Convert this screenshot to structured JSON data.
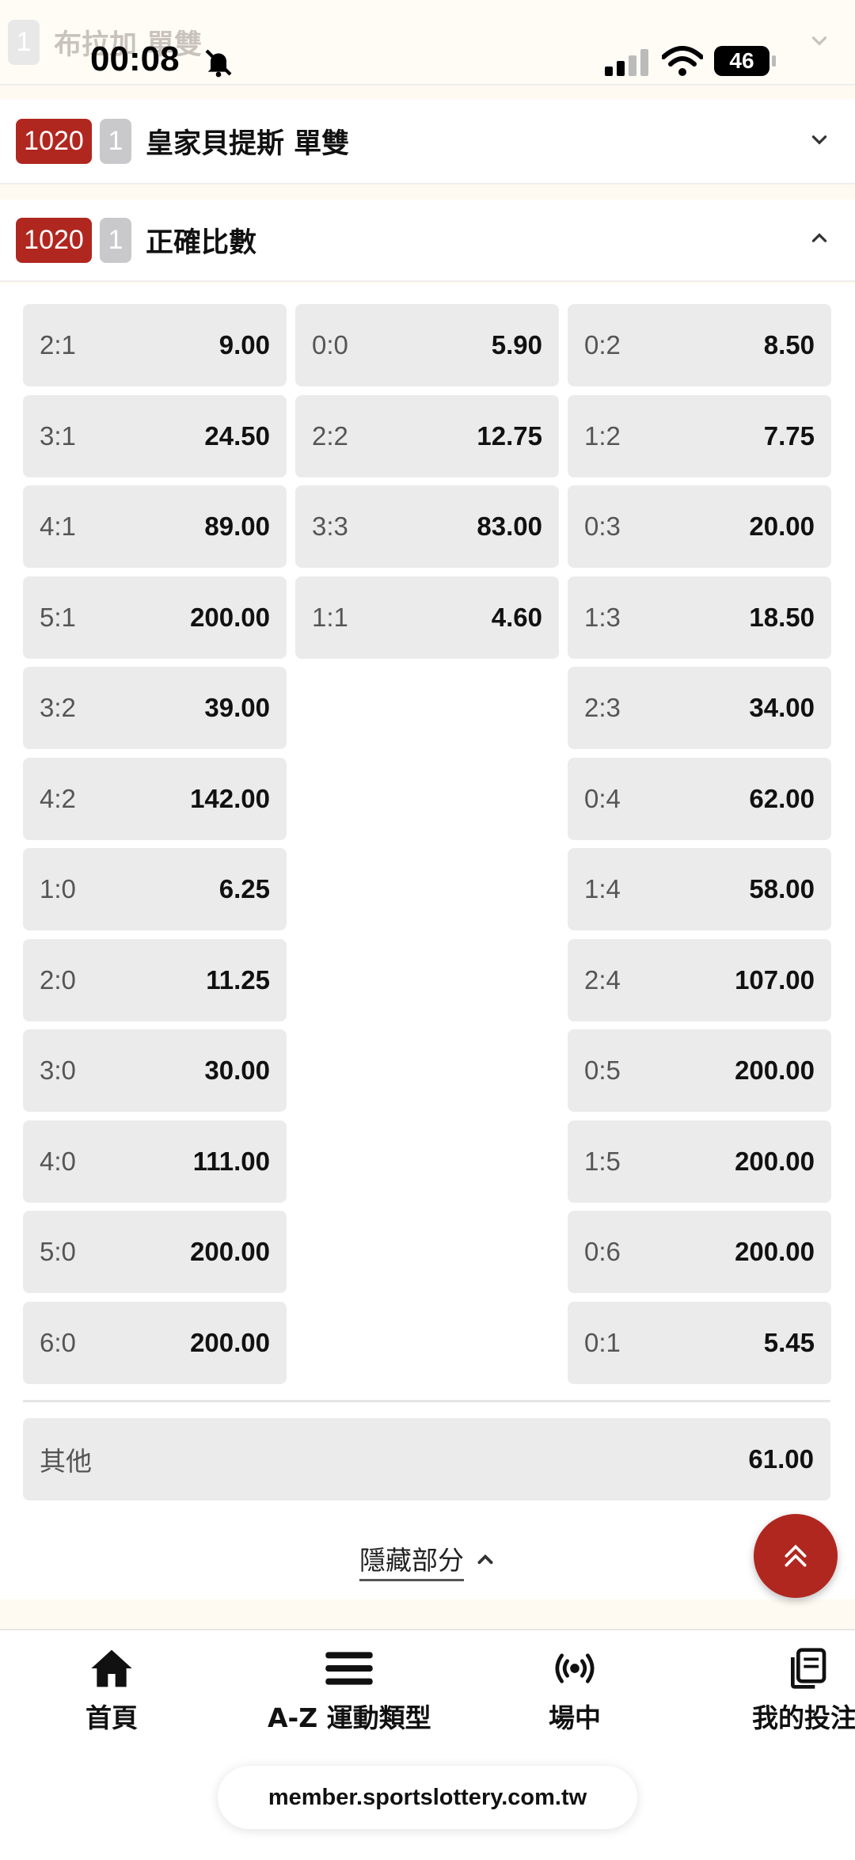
{
  "status_bar": {
    "time": "00:08",
    "battery": "46"
  },
  "markets": [
    {
      "count": "1",
      "title": "布拉加 單雙"
    },
    {
      "code": "1020",
      "count": "1",
      "title": "皇家貝提斯 單雙"
    },
    {
      "code": "1020",
      "count": "1",
      "title": "正確比數"
    }
  ],
  "correct_score": {
    "col1": [
      {
        "score": "2:1",
        "odds": "9.00"
      },
      {
        "score": "3:1",
        "odds": "24.50"
      },
      {
        "score": "4:1",
        "odds": "89.00"
      },
      {
        "score": "5:1",
        "odds": "200.00"
      },
      {
        "score": "3:2",
        "odds": "39.00"
      },
      {
        "score": "4:2",
        "odds": "142.00"
      },
      {
        "score": "1:0",
        "odds": "6.25"
      },
      {
        "score": "2:0",
        "odds": "11.25"
      },
      {
        "score": "3:0",
        "odds": "30.00"
      },
      {
        "score": "4:0",
        "odds": "111.00"
      },
      {
        "score": "5:0",
        "odds": "200.00"
      },
      {
        "score": "6:0",
        "odds": "200.00"
      }
    ],
    "col2": [
      {
        "score": "0:0",
        "odds": "5.90"
      },
      {
        "score": "2:2",
        "odds": "12.75"
      },
      {
        "score": "3:3",
        "odds": "83.00"
      },
      {
        "score": "1:1",
        "odds": "4.60"
      }
    ],
    "col3": [
      {
        "score": "0:2",
        "odds": "8.50"
      },
      {
        "score": "1:2",
        "odds": "7.75"
      },
      {
        "score": "0:3",
        "odds": "20.00"
      },
      {
        "score": "1:3",
        "odds": "18.50"
      },
      {
        "score": "2:3",
        "odds": "34.00"
      },
      {
        "score": "0:4",
        "odds": "62.00"
      },
      {
        "score": "1:4",
        "odds": "58.00"
      },
      {
        "score": "2:4",
        "odds": "107.00"
      },
      {
        "score": "0:5",
        "odds": "200.00"
      },
      {
        "score": "1:5",
        "odds": "200.00"
      },
      {
        "score": "0:6",
        "odds": "200.00"
      },
      {
        "score": "0:1",
        "odds": "5.45"
      }
    ],
    "other": {
      "label": "其他",
      "odds": "61.00"
    }
  },
  "hide_label": "隱藏部分",
  "bottom_nav": [
    {
      "label": "首頁",
      "icon": "home-icon"
    },
    {
      "label": "A-Z 運動類型",
      "icon": "menu-icon"
    },
    {
      "label": "場中",
      "icon": "live-broadcast-icon"
    },
    {
      "label": "我的投注",
      "icon": "documents-icon"
    }
  ],
  "url": "member.sportslottery.com.tw",
  "colors": {
    "accent": "#b0271f",
    "cell_bg": "#ebebeb",
    "count_badge": "#c9c9cc"
  }
}
